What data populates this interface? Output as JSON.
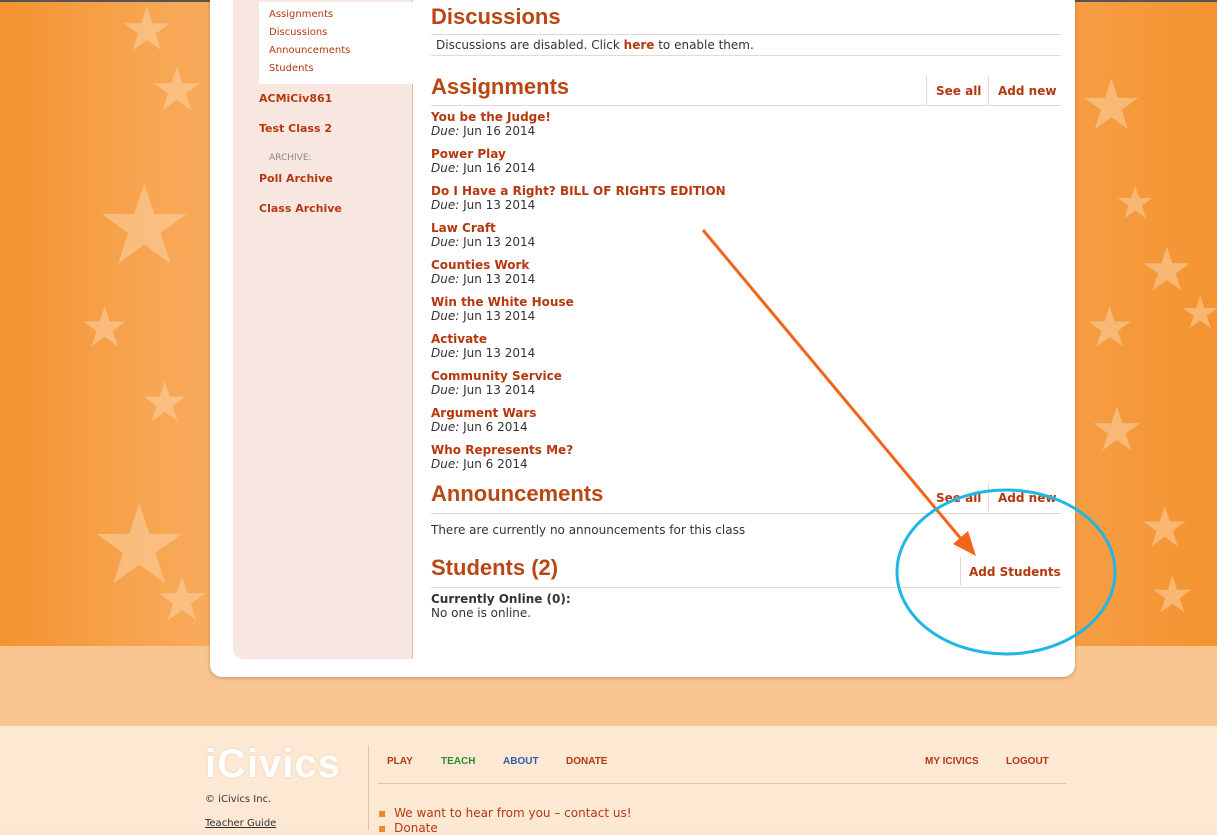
{
  "sidebar": {
    "sub_items": [
      "Assignments",
      "Discussions",
      "Announcements",
      "Students"
    ],
    "classes": [
      "ACMiCiv861",
      "Test Class 2"
    ],
    "archive_label": "ARCHIVE:",
    "archive_items": [
      "Poll Archive",
      "Class Archive"
    ]
  },
  "discussions": {
    "title": "Discussions",
    "text_before": "Discussions are disabled. Click ",
    "link": "here",
    "text_after": " to enable them."
  },
  "assignments": {
    "title": "Assignments",
    "see_all": "See all",
    "add_new": "Add new",
    "due_label": "Due:",
    "items": [
      {
        "title": "You be the Judge!",
        "due": "Jun 16 2014"
      },
      {
        "title": "Power Play",
        "due": "Jun 16 2014"
      },
      {
        "title": "Do I Have a Right? BILL OF RIGHTS EDITION",
        "due": "Jun 13 2014"
      },
      {
        "title": "Law Craft",
        "due": "Jun 13 2014"
      },
      {
        "title": "Counties Work",
        "due": "Jun 13 2014"
      },
      {
        "title": "Win the White House",
        "due": "Jun 13 2014"
      },
      {
        "title": "Activate",
        "due": "Jun 13 2014"
      },
      {
        "title": "Community Service",
        "due": "Jun 13 2014"
      },
      {
        "title": "Argument Wars",
        "due": "Jun 6 2014"
      },
      {
        "title": "Who Represents Me?",
        "due": "Jun 6 2014"
      }
    ]
  },
  "announcements": {
    "title": "Announcements",
    "see_all": "See all",
    "add_new": "Add new",
    "empty_text": "There are currently no announcements for this class"
  },
  "students": {
    "title": "Students (2)",
    "add_students": "Add Students",
    "online_label": "Currently Online (0):",
    "online_text": "No one is online."
  },
  "footer": {
    "logo": "iCivics",
    "nav": [
      {
        "label": "PLAY",
        "color": "#b5380f"
      },
      {
        "label": "TEACH",
        "color": "#2e8a2e"
      },
      {
        "label": "ABOUT",
        "color": "#2b5fa8"
      },
      {
        "label": "DONATE",
        "color": "#b5380f"
      }
    ],
    "nav_right": [
      "MY ICIVICS",
      "LOGOUT"
    ],
    "copyright": "© iCivics Inc.",
    "teacher_guide": "Teacher Guide",
    "bullets": [
      "We want to hear from you – contact us!",
      "Donate"
    ]
  },
  "colors": {
    "accent": "#b94713",
    "link": "#b5380f",
    "annotation_arrow": "#f2641a",
    "annotation_circle": "#1fb6e6"
  },
  "annotations": {
    "arrow_icon": "arrow-icon",
    "circle_icon": "highlight-circle-icon"
  }
}
